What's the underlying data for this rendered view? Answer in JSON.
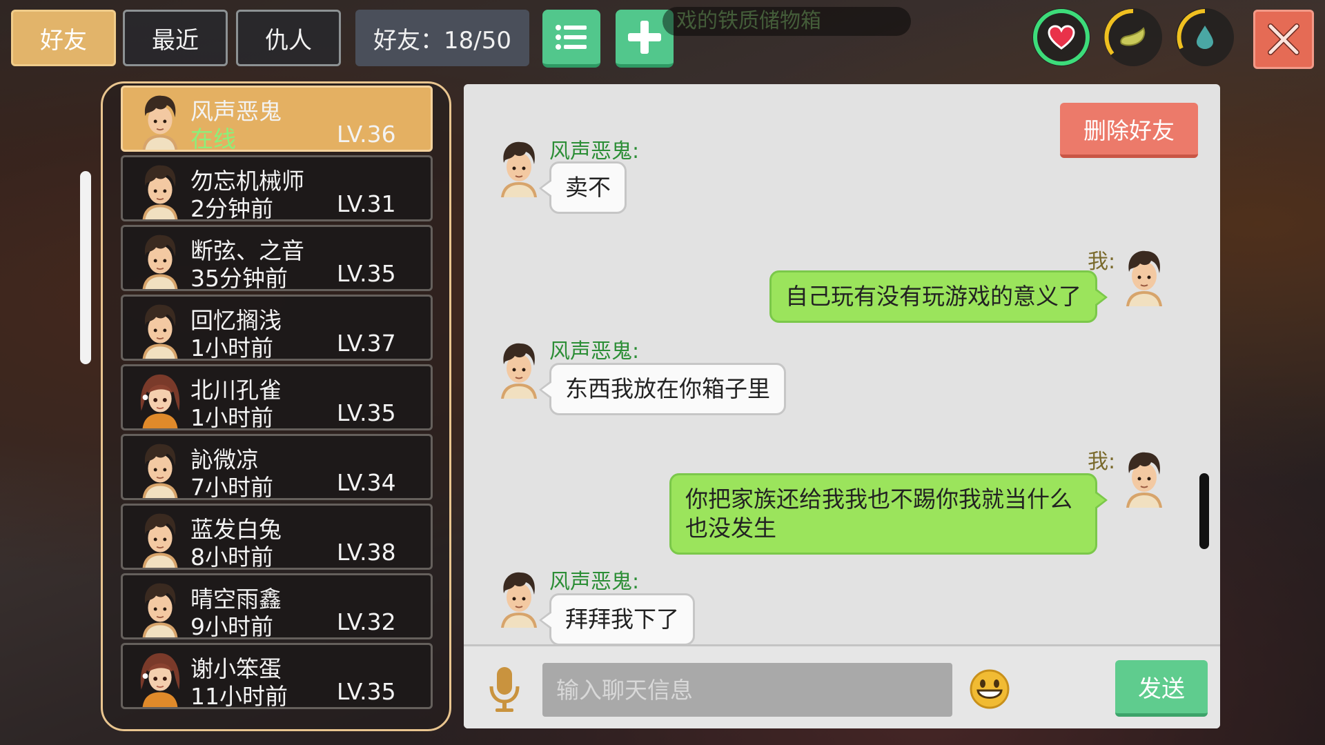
{
  "tabs": [
    {
      "label": "好友",
      "active": true
    },
    {
      "label": "最近",
      "active": false
    },
    {
      "label": "仇人",
      "active": false
    }
  ],
  "counter": "好友：18/50",
  "banner_text": "戏的铁质储物箱",
  "buttons": {
    "list_icon": "list-icon",
    "add_icon": "plus-icon",
    "close_icon": "close-icon"
  },
  "stats": [
    {
      "name": "health",
      "icon": "heart-icon",
      "ring_color": "#3ddc7a",
      "level": 1.0
    },
    {
      "name": "hunger",
      "icon": "food-icon",
      "ring_color": "#f0c020",
      "level": 0.55
    },
    {
      "name": "thirst",
      "icon": "water-drop-icon",
      "ring_color": "#f0c020",
      "level": 0.45
    }
  ],
  "friends": [
    {
      "name": "风声恶鬼",
      "status": "在线",
      "level": "LV.36",
      "selected": true,
      "avatar": "boy"
    },
    {
      "name": "勿忘机械师",
      "status": "2分钟前",
      "level": "LV.31",
      "avatar": "boy"
    },
    {
      "name": "断弦、之音",
      "status": "35分钟前",
      "level": "LV.35",
      "avatar": "boy"
    },
    {
      "name": "回忆搁浅",
      "status": "1小时前",
      "level": "LV.37",
      "avatar": "boy"
    },
    {
      "name": "北川孔雀",
      "status": "1小时前",
      "level": "LV.35",
      "avatar": "girl"
    },
    {
      "name": "訫微凉",
      "status": "7小时前",
      "level": "LV.34",
      "avatar": "boy"
    },
    {
      "name": "蓝发白兔",
      "status": "8小时前",
      "level": "LV.38",
      "avatar": "boy"
    },
    {
      "name": "晴空雨鑫",
      "status": "9小时前",
      "level": "LV.32",
      "avatar": "boy"
    },
    {
      "name": "谢小笨蛋",
      "status": "11小时前",
      "level": "LV.35",
      "avatar": "girl"
    }
  ],
  "chat": {
    "delete_label": "删除好友",
    "messages": [
      {
        "from": "other",
        "sender": "风声恶鬼:",
        "text": "卖不"
      },
      {
        "from": "me",
        "sender": "我:",
        "text": "自己玩有没有玩游戏的意义了"
      },
      {
        "from": "other",
        "sender": "风声恶鬼:",
        "text": "东西我放在你箱子里"
      },
      {
        "from": "me",
        "sender": "我:",
        "text": "你把家族还给我我也不踢你我就当什么也没发生"
      },
      {
        "from": "other",
        "sender": "风声恶鬼:",
        "text": "拜拜我下了"
      }
    ],
    "input_placeholder": "输入聊天信息",
    "send_label": "发送",
    "mic_icon": "microphone-icon",
    "emoji_icon": "smiley-icon"
  },
  "colors": {
    "accent": "#e2b46a",
    "green": "#52c78c",
    "danger": "#e56b55",
    "bubble_mine": "#9be45c"
  }
}
